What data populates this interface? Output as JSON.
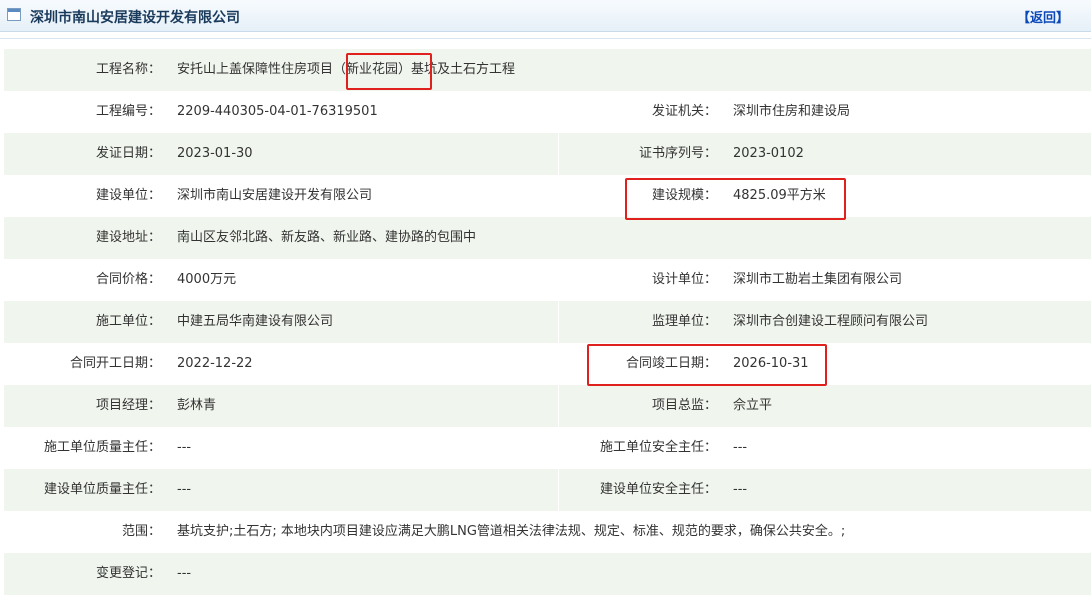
{
  "header": {
    "title": "深圳市南山安居建设开发有限公司",
    "back_label": "【返回】"
  },
  "rows": [
    {
      "label": "工程名称：",
      "value": "安托山上盖保障性住房项目（新业花园）基坑及土石方工程"
    },
    {
      "label": "工程编号：",
      "value": "2209-440305-04-01-76319501",
      "label2": "发证机关：",
      "value2": "深圳市住房和建设局"
    },
    {
      "label": "发证日期：",
      "value": "2023-01-30",
      "label2": "证书序列号：",
      "value2": "2023-0102"
    },
    {
      "label": "建设单位：",
      "value": "深圳市南山安居建设开发有限公司",
      "label2": "建设规模：",
      "value2": "4825.09平方米"
    },
    {
      "label": "建设地址：",
      "value": "南山区友邻北路、新友路、新业路、建协路的包围中"
    },
    {
      "label": "合同价格：",
      "value": "4000万元",
      "label2": "设计单位：",
      "value2": "深圳市工勘岩土集团有限公司"
    },
    {
      "label": "施工单位：",
      "value": "中建五局华南建设有限公司",
      "label2": "监理单位：",
      "value2": "深圳市合创建设工程顾问有限公司"
    },
    {
      "label": "合同开工日期：",
      "value": "2022-12-22",
      "label2": "合同竣工日期：",
      "value2": "2026-10-31"
    },
    {
      "label": "项目经理：",
      "value": "彭林青",
      "label2": "项目总监：",
      "value2": "佘立平"
    },
    {
      "label": "施工单位质量主任：",
      "value": "---",
      "label2": "施工单位安全主任：",
      "value2": "---"
    },
    {
      "label": "建设单位质量主任：",
      "value": "---",
      "label2": "建设单位安全主任：",
      "value2": "---"
    },
    {
      "label": "范围：",
      "value": "基坑支护;土石方; 本地块内项目建设应满足大鹏LNG管道相关法律法规、规定、标准、规范的要求，确保公共安全。;"
    },
    {
      "label": "变更登记：",
      "value": "---"
    }
  ],
  "annotation_color": "#e0201c"
}
